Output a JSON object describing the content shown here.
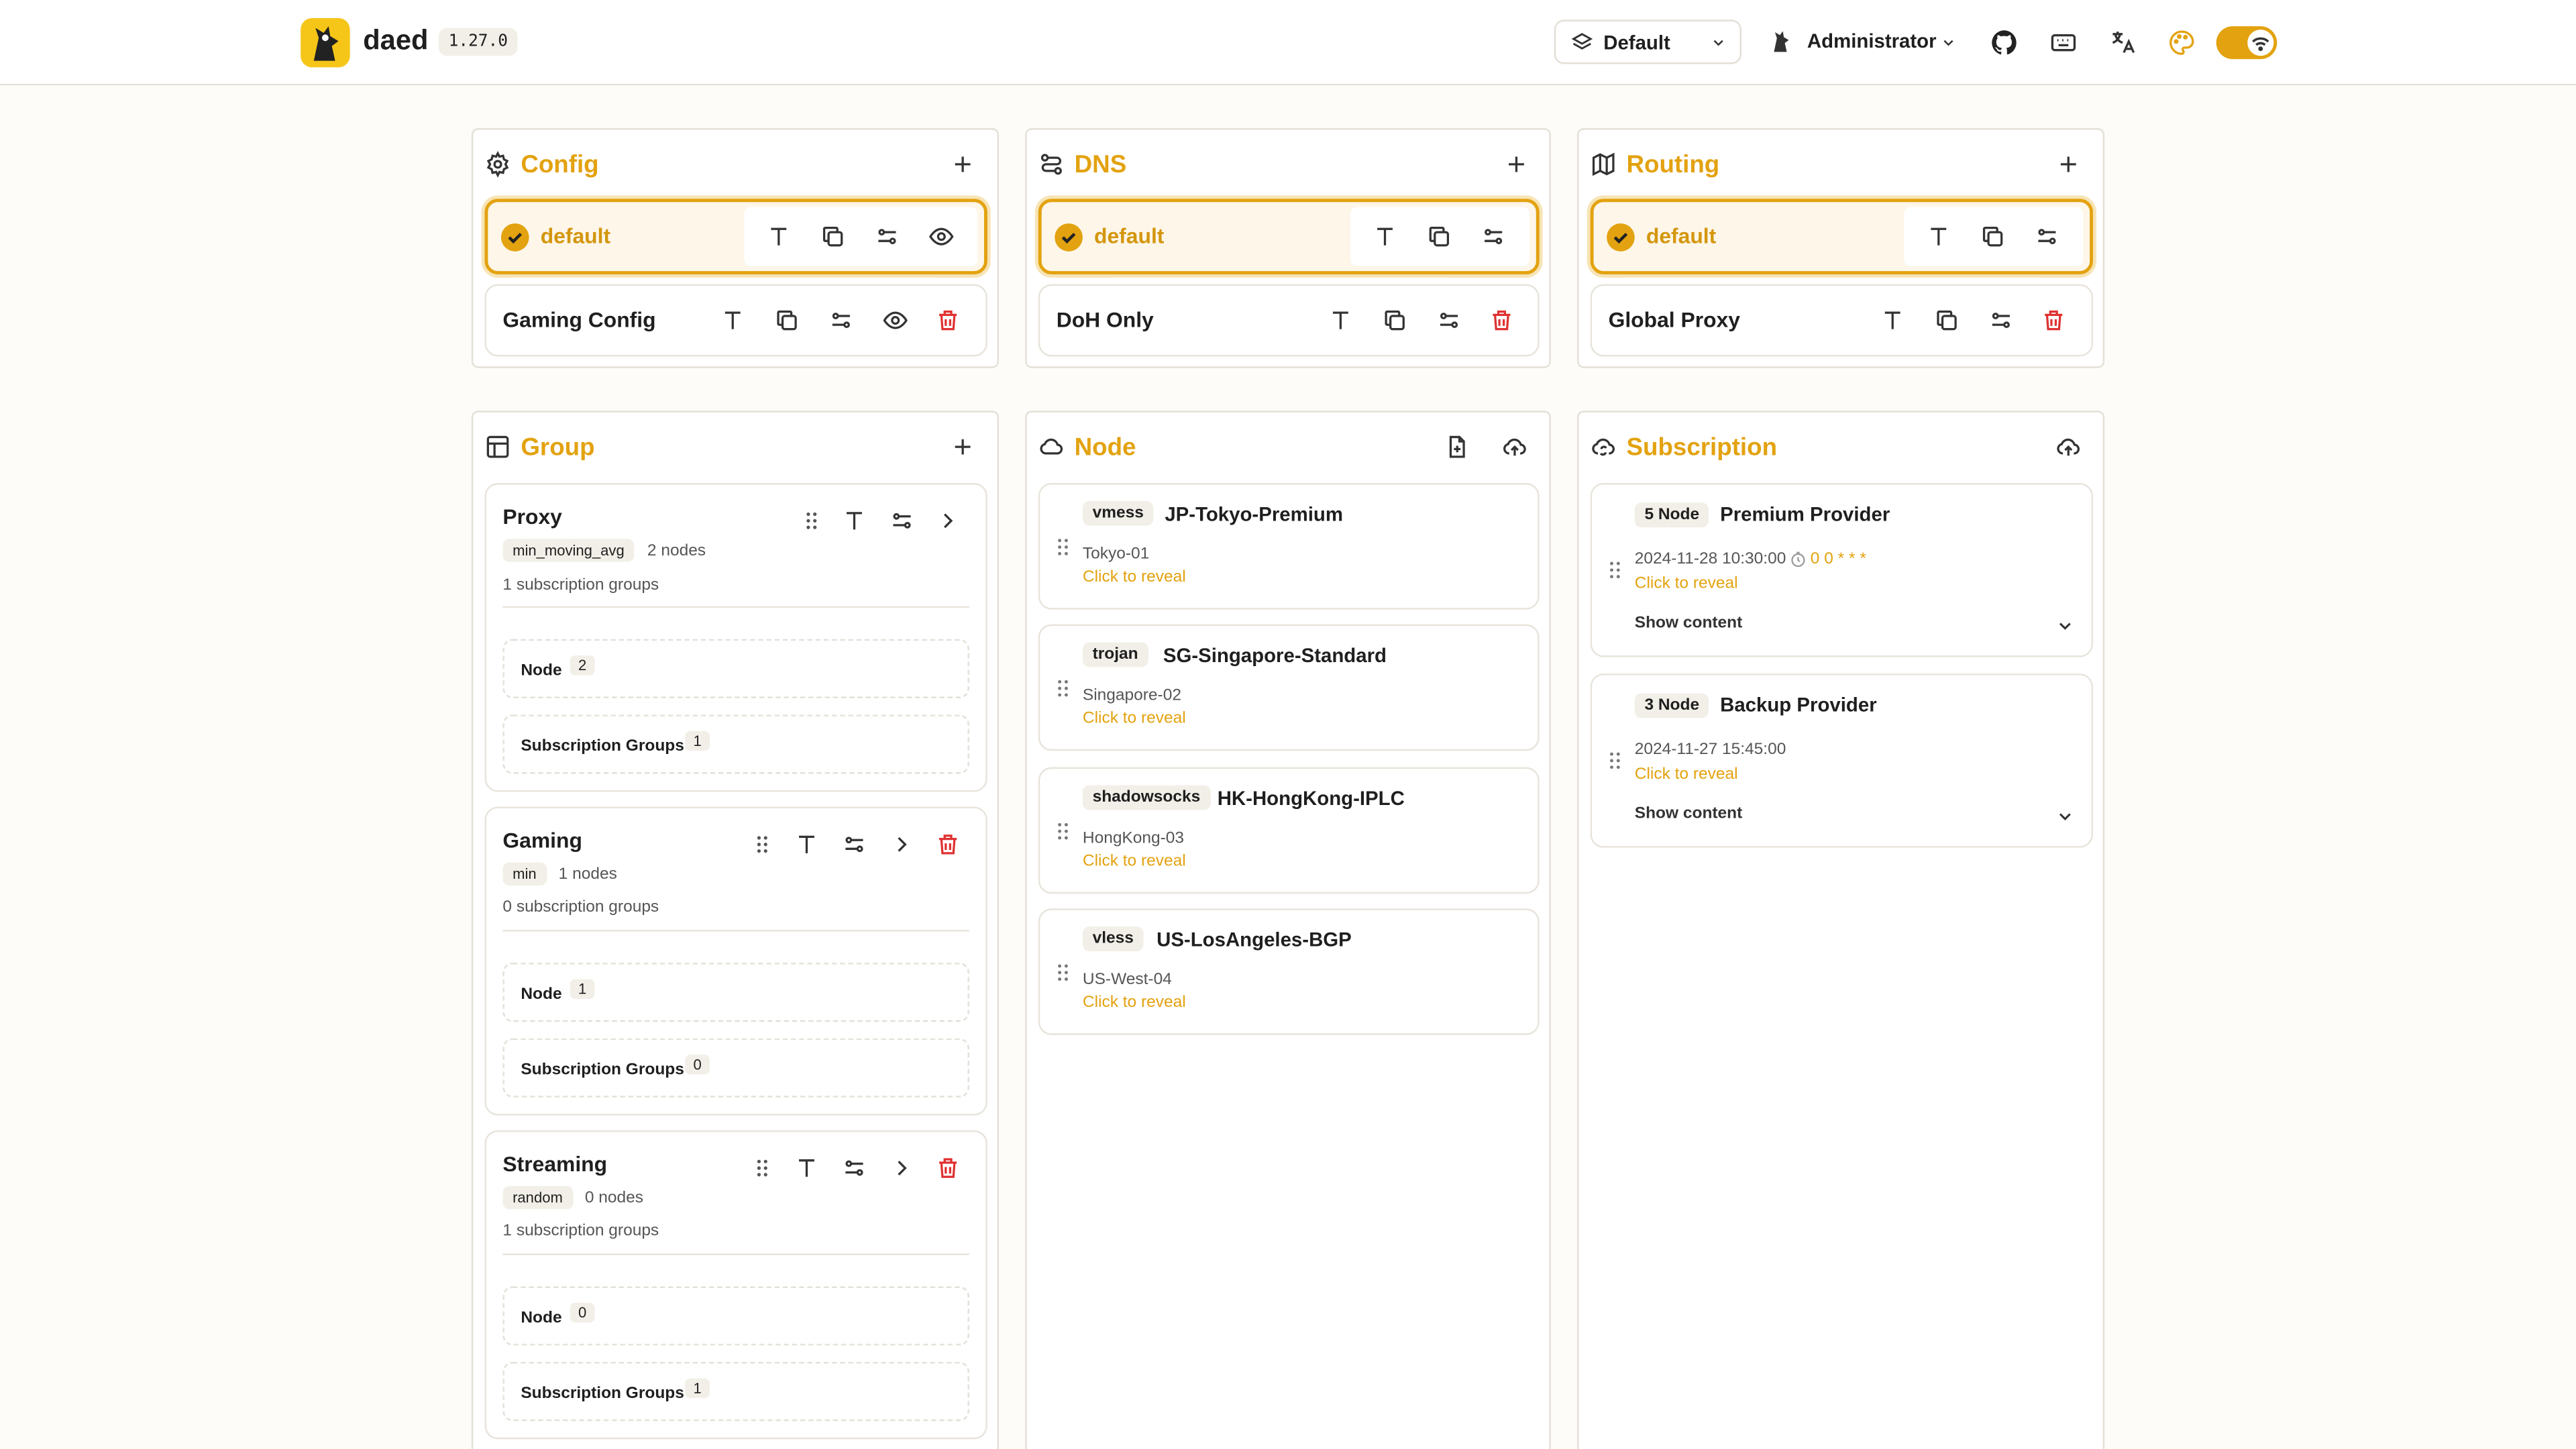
{
  "header": {
    "brand": "daed",
    "version": "1.27.0",
    "profile": "Default",
    "user": "Administrator"
  },
  "colors": {
    "accent": "#e3a20f",
    "danger": "#e03131"
  },
  "icons": [
    "github-icon",
    "keyboard-icon",
    "translate-icon",
    "palette-icon",
    "wifi-icon"
  ],
  "config": {
    "title": "Config",
    "items": [
      {
        "name": "default",
        "selected": true
      },
      {
        "name": "Gaming Config",
        "selected": false
      }
    ]
  },
  "dns": {
    "title": "DNS",
    "items": [
      {
        "name": "default",
        "selected": true
      },
      {
        "name": "DoH Only",
        "selected": false
      }
    ]
  },
  "routing": {
    "title": "Routing",
    "items": [
      {
        "name": "default",
        "selected": true
      },
      {
        "name": "Global Proxy",
        "selected": false
      }
    ]
  },
  "group": {
    "title": "Group",
    "node_label": "Node",
    "sub_label": "Subscription Groups",
    "items": [
      {
        "name": "Proxy",
        "policy": "min_moving_avg",
        "nodes": "2 nodes",
        "subs": "1 subscription groups",
        "node_count": "2",
        "sub_count": "1"
      },
      {
        "name": "Gaming",
        "policy": "min",
        "nodes": "1 nodes",
        "subs": "0 subscription groups",
        "node_count": "1",
        "sub_count": "0"
      },
      {
        "name": "Streaming",
        "policy": "random",
        "nodes": "0 nodes",
        "subs": "1 subscription groups",
        "node_count": "0",
        "sub_count": "1"
      }
    ]
  },
  "node": {
    "title": "Node",
    "reveal": "Click to reveal",
    "items": [
      {
        "protocol": "vmess",
        "name": "JP-Tokyo-Premium",
        "tag": "Tokyo-01"
      },
      {
        "protocol": "trojan",
        "name": "SG-Singapore-Standard",
        "tag": "Singapore-02"
      },
      {
        "protocol": "shadowsocks",
        "name": "HK-HongKong-IPLC",
        "tag": "HongKong-03"
      },
      {
        "protocol": "vless",
        "name": "US-LosAngeles-BGP",
        "tag": "US-West-04"
      }
    ]
  },
  "subscription": {
    "title": "Subscription",
    "reveal": "Click to reveal",
    "show_content": "Show content",
    "items": [
      {
        "count": "5 Node",
        "name": "Premium Provider",
        "updated": "2024-11-28 10:30:00",
        "cron": "0 0 * * *"
      },
      {
        "count": "3 Node",
        "name": "Backup Provider",
        "updated": "2024-11-27 15:45:00",
        "cron": ""
      }
    ]
  }
}
